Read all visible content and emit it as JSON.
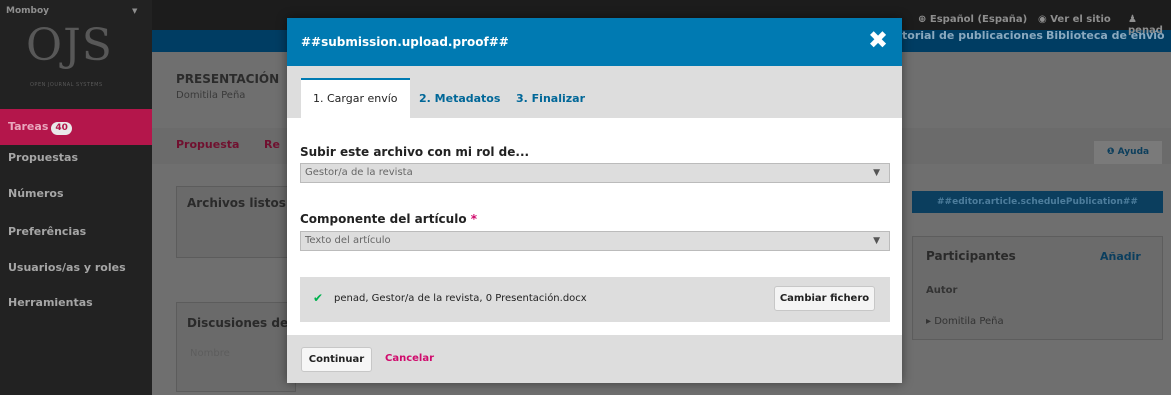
{
  "sidebar": {
    "journal_name": "Momboy",
    "logo": "OJS",
    "logo_subtitle": "OPEN JOURNAL SYSTEMS",
    "items": [
      {
        "label": "Tareas",
        "badge": "40"
      },
      {
        "label": "Propuestas"
      },
      {
        "label": "Números"
      },
      {
        "label": "Preferências"
      },
      {
        "label": "Usuarios/as y roles"
      },
      {
        "label": "Herramientas"
      }
    ]
  },
  "topbar": {
    "language": "Español (España)",
    "view_site": "Ver el sitio",
    "user": "penad"
  },
  "nav": {
    "publishing": "torial de publicaciones",
    "library": "Biblioteca de envío"
  },
  "background": {
    "stage": "PRESENTACIÓN",
    "author": "Domitila Peña",
    "tab_proposal": "Propuesta",
    "tab_review": "Re",
    "help": "Ayuda",
    "files_ready": "Archivos listos p",
    "discussions": "Discusiones de p",
    "name_col": "Nombre",
    "schedule_button": "##editor.article.schedulePublication##",
    "participants": "Participantes",
    "add": "Añadir",
    "author_role": "Autor",
    "participant_name": "Domitila Peña"
  },
  "modal": {
    "title": "##submission.upload.proof##",
    "tabs": [
      "1. Cargar envío",
      "2. Metadatos",
      "3. Finalizar"
    ],
    "role_label": "Subir este archivo con mi rol de...",
    "role_value": "Gestor/a de la revista",
    "component_label": "Componente del artículo",
    "component_required": "*",
    "component_value": "Texto del artículo",
    "file_info": "penad, Gestor/a de la revista, 0 Presentación.docx",
    "change_button": "Cambiar fichero",
    "continue_button": "Continuar",
    "cancel_link": "Cancelar"
  },
  "colors": {
    "modal_header": "#007ab2",
    "sidebar_active": "#b4164b",
    "link": "#006798",
    "cancel": "#d00a6c",
    "check": "#00b24e"
  }
}
